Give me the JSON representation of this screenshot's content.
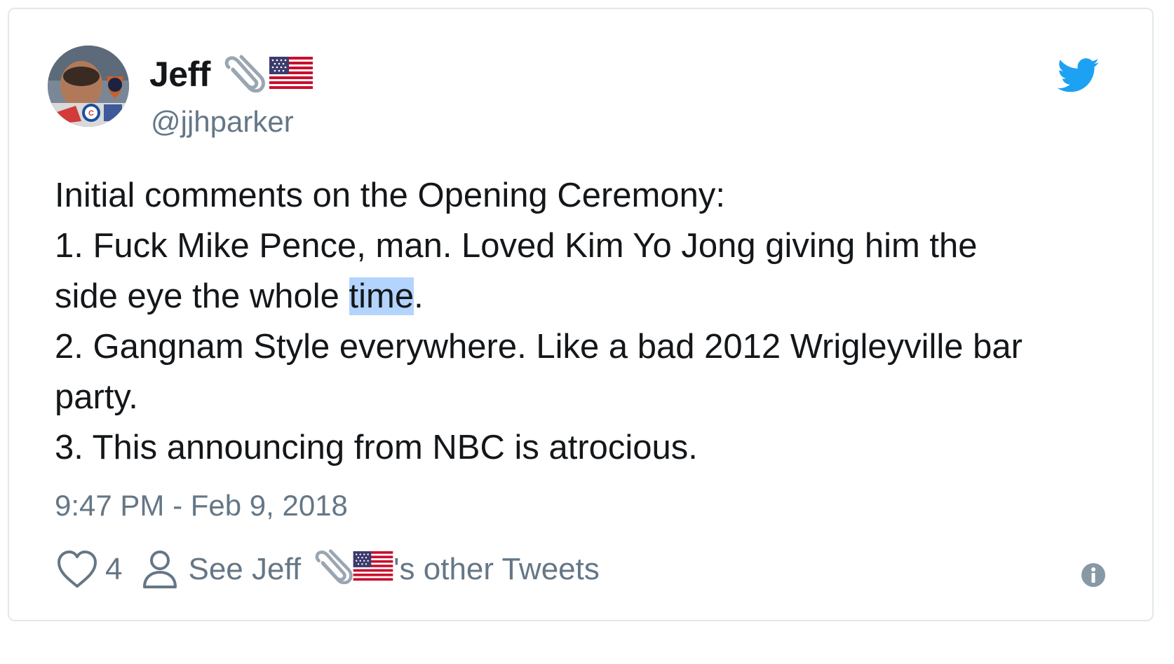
{
  "author": {
    "name": "Jeff",
    "handle": "@jjhparker",
    "name_icons": [
      "paperclip-icon",
      "us-flag-icon"
    ]
  },
  "tweet": {
    "lines": [
      "Initial comments on the Opening Ceremony:",
      "1. Fuck Mike Pence, man. Loved Kim Yo Jong giving him the",
      "side eye the whole ",
      "time",
      ".",
      "2. Gangnam Style everywhere. Like a bad 2012 Wrigleyville bar",
      "party.",
      "3. This announcing from NBC is atrocious."
    ],
    "timestamp": "9:47 PM - Feb 9, 2018"
  },
  "actions": {
    "like_count": "4",
    "other_tweets_prefix": "See Jeff",
    "other_tweets_suffix": "'s other Tweets"
  },
  "colors": {
    "text": "#14171a",
    "muted": "#657786",
    "twitter_blue": "#1da1f2",
    "selection": "#b3d4fc",
    "border": "#e1e8ed"
  },
  "icons": {
    "brand": "twitter-bird-icon",
    "like": "heart-icon",
    "profile": "person-icon",
    "info": "info-icon"
  }
}
